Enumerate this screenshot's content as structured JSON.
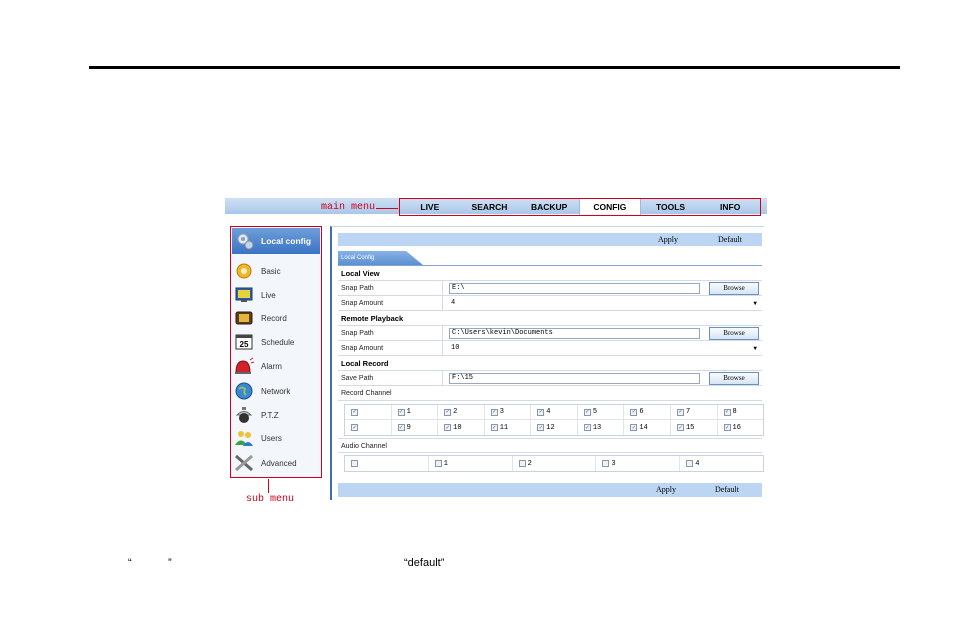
{
  "annotations": {
    "main_menu": "main menu",
    "sub_menu": "sub menu"
  },
  "main_menu": [
    {
      "label": "LIVE"
    },
    {
      "label": "SEARCH"
    },
    {
      "label": "BACKUP"
    },
    {
      "label": "CONFIG",
      "active": true
    },
    {
      "label": "TOOLS"
    },
    {
      "label": "INFO"
    }
  ],
  "sidebar": {
    "header": "Local config",
    "items": [
      {
        "label": "Basic",
        "icon": "gear-icon"
      },
      {
        "label": "Live",
        "icon": "monitor-icon"
      },
      {
        "label": "Record",
        "icon": "record-icon"
      },
      {
        "label": "Schedule",
        "icon": "calendar-icon",
        "icon_text": "25"
      },
      {
        "label": "Alarm",
        "icon": "alarm-icon"
      },
      {
        "label": "Network",
        "icon": "globe-icon"
      },
      {
        "label": "P.T.Z",
        "icon": "ptz-camera-icon"
      },
      {
        "label": "Users",
        "icon": "users-icon"
      },
      {
        "label": "Advanced",
        "icon": "tools-icon"
      }
    ]
  },
  "panel": {
    "apply_label": "Apply",
    "default_label": "Default",
    "tab_label": "Local Config",
    "browse_label": "Browse",
    "local_view": {
      "title": "Local View",
      "snap_path_label": "Snap Path",
      "snap_path_value": "E:\\",
      "snap_amount_label": "Snap Amount",
      "snap_amount_value": "4"
    },
    "remote_playback": {
      "title": "Remote Playback",
      "snap_path_label": "Snap Path",
      "snap_path_value": "C:\\Users\\kevin\\Documents",
      "snap_amount_label": "Snap Amount",
      "snap_amount_value": "10"
    },
    "local_record": {
      "title": "Local Record",
      "save_path_label": "Save Path",
      "save_path_value": "F:\\15",
      "record_channel_label": "Record Channel",
      "record_channels_row1": [
        "",
        "1",
        "2",
        "3",
        "4",
        "5",
        "6",
        "7",
        "8"
      ],
      "record_channels_row2": [
        "",
        "9",
        "10",
        "11",
        "12",
        "13",
        "14",
        "15",
        "16"
      ],
      "audio_channel_label": "Audio Channel",
      "audio_channels": [
        "",
        "1",
        "2",
        "3",
        "4"
      ]
    }
  },
  "captions": {
    "quote_left": "“",
    "quote_right": "”",
    "default_text": "“default”"
  },
  "colors": {
    "annotation": "#d0021b",
    "accent": "#3d6fb6",
    "bar": "#bcd5f2"
  }
}
